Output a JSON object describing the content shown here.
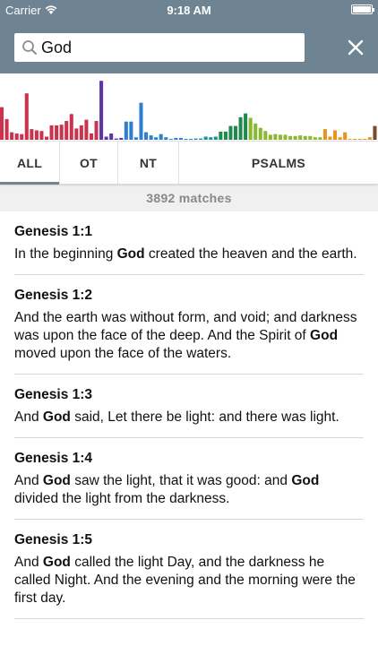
{
  "status_bar": {
    "carrier": "Carrier",
    "time": "9:18 AM",
    "battery_level": 1.0
  },
  "search": {
    "query": "God"
  },
  "colors": {
    "header": "#6e8492",
    "accent": "#6e8492"
  },
  "histogram": {
    "bars": [
      {
        "h": 0.52,
        "c": "#c9334d"
      },
      {
        "h": 0.33,
        "c": "#c9334d"
      },
      {
        "h": 0.12,
        "c": "#c9334d"
      },
      {
        "h": 0.1,
        "c": "#c9334d"
      },
      {
        "h": 0.09,
        "c": "#c9334d"
      },
      {
        "h": 0.74,
        "c": "#c9334d"
      },
      {
        "h": 0.17,
        "c": "#c9334d"
      },
      {
        "h": 0.15,
        "c": "#c9334d"
      },
      {
        "h": 0.14,
        "c": "#c9334d"
      },
      {
        "h": 0.05,
        "c": "#c9334d"
      },
      {
        "h": 0.23,
        "c": "#c9334d"
      },
      {
        "h": 0.23,
        "c": "#c9334d"
      },
      {
        "h": 0.24,
        "c": "#c9334d"
      },
      {
        "h": 0.3,
        "c": "#c9334d"
      },
      {
        "h": 0.41,
        "c": "#c9334d"
      },
      {
        "h": 0.18,
        "c": "#c9334d"
      },
      {
        "h": 0.23,
        "c": "#c9334d"
      },
      {
        "h": 0.32,
        "c": "#c9334d"
      },
      {
        "h": 0.1,
        "c": "#c9334d"
      },
      {
        "h": 0.3,
        "c": "#c9334d"
      },
      {
        "h": 0.94,
        "c": "#5d35a6"
      },
      {
        "h": 0.05,
        "c": "#5d35a6"
      },
      {
        "h": 0.1,
        "c": "#5d35a6"
      },
      {
        "h": 0.02,
        "c": "#5d35a6"
      },
      {
        "h": 0.03,
        "c": "#5d35a6"
      },
      {
        "h": 0.29,
        "c": "#2f7fd0"
      },
      {
        "h": 0.29,
        "c": "#2f7fd0"
      },
      {
        "h": 0.04,
        "c": "#2f7fd0"
      },
      {
        "h": 0.59,
        "c": "#2f7fd0"
      },
      {
        "h": 0.12,
        "c": "#2f7fd0"
      },
      {
        "h": 0.07,
        "c": "#2f7fd0"
      },
      {
        "h": 0.04,
        "c": "#2f7fd0"
      },
      {
        "h": 0.09,
        "c": "#2f7fd0"
      },
      {
        "h": 0.04,
        "c": "#2f7fd0"
      },
      {
        "h": 0.01,
        "c": "#2f7fd0"
      },
      {
        "h": 0.03,
        "c": "#2f7fd0"
      },
      {
        "h": 0.03,
        "c": "#2f7fd0"
      },
      {
        "h": 0.01,
        "c": "#2f7fd0"
      },
      {
        "h": 0.01,
        "c": "#2f7fd0"
      },
      {
        "h": 0.02,
        "c": "#19909a"
      },
      {
        "h": 0.02,
        "c": "#19909a"
      },
      {
        "h": 0.05,
        "c": "#19909a"
      },
      {
        "h": 0.04,
        "c": "#19909a"
      },
      {
        "h": 0.05,
        "c": "#19909a"
      },
      {
        "h": 0.13,
        "c": "#1e8a4e"
      },
      {
        "h": 0.13,
        "c": "#1e8a4e"
      },
      {
        "h": 0.22,
        "c": "#1e8a4e"
      },
      {
        "h": 0.22,
        "c": "#1e8a4e"
      },
      {
        "h": 0.36,
        "c": "#1e8a4e"
      },
      {
        "h": 0.42,
        "c": "#1e8a4e"
      },
      {
        "h": 0.35,
        "c": "#8ab832"
      },
      {
        "h": 0.26,
        "c": "#8ab832"
      },
      {
        "h": 0.19,
        "c": "#8ab832"
      },
      {
        "h": 0.14,
        "c": "#8ab832"
      },
      {
        "h": 0.08,
        "c": "#8ab832"
      },
      {
        "h": 0.09,
        "c": "#8ab832"
      },
      {
        "h": 0.08,
        "c": "#8ab832"
      },
      {
        "h": 0.08,
        "c": "#8ab832"
      },
      {
        "h": 0.06,
        "c": "#8ab832"
      },
      {
        "h": 0.06,
        "c": "#8ab832"
      },
      {
        "h": 0.07,
        "c": "#8ab832"
      },
      {
        "h": 0.06,
        "c": "#8ab832"
      },
      {
        "h": 0.06,
        "c": "#8ab832"
      },
      {
        "h": 0.04,
        "c": "#8ab832"
      },
      {
        "h": 0.04,
        "c": "#8ab832"
      },
      {
        "h": 0.17,
        "c": "#e8931c"
      },
      {
        "h": 0.05,
        "c": "#e8931c"
      },
      {
        "h": 0.15,
        "c": "#e8931c"
      },
      {
        "h": 0.04,
        "c": "#e8931c"
      },
      {
        "h": 0.12,
        "c": "#e8931c"
      },
      {
        "h": 0.01,
        "c": "#e8931c"
      },
      {
        "h": 0.01,
        "c": "#e8931c"
      },
      {
        "h": 0.01,
        "c": "#e8931c"
      },
      {
        "h": 0.01,
        "c": "#e8931c"
      },
      {
        "h": 0.04,
        "c": "#e8931c"
      },
      {
        "h": 0.22,
        "c": "#7b4a2e"
      }
    ]
  },
  "tabs": [
    {
      "label": "ALL",
      "active": true
    },
    {
      "label": "OT",
      "active": false
    },
    {
      "label": "NT",
      "active": false
    },
    {
      "label": "PSALMS",
      "active": false
    }
  ],
  "match_count": "3892 matches",
  "results": [
    {
      "ref": "Genesis 1:1",
      "segments": [
        {
          "t": "In the beginning "
        },
        {
          "t": "God",
          "b": true
        },
        {
          "t": " created the heaven and the earth."
        }
      ]
    },
    {
      "ref": "Genesis 1:2",
      "segments": [
        {
          "t": "And the earth was without form, and void; and darkness was upon the face of the deep. And the Spirit of "
        },
        {
          "t": "God",
          "b": true
        },
        {
          "t": " moved upon the face of the waters."
        }
      ]
    },
    {
      "ref": "Genesis 1:3",
      "segments": [
        {
          "t": "And "
        },
        {
          "t": "God",
          "b": true
        },
        {
          "t": " said, Let there be light: and there was light."
        }
      ]
    },
    {
      "ref": "Genesis 1:4",
      "segments": [
        {
          "t": "And "
        },
        {
          "t": "God",
          "b": true
        },
        {
          "t": " saw the light, that it was good: and "
        },
        {
          "t": "God",
          "b": true
        },
        {
          "t": " divided the light from the darkness."
        }
      ]
    },
    {
      "ref": "Genesis 1:5",
      "segments": [
        {
          "t": "And "
        },
        {
          "t": "God",
          "b": true
        },
        {
          "t": " called the light Day, and the darkness he called Night. And the evening and the morning were the first day."
        }
      ]
    }
  ]
}
